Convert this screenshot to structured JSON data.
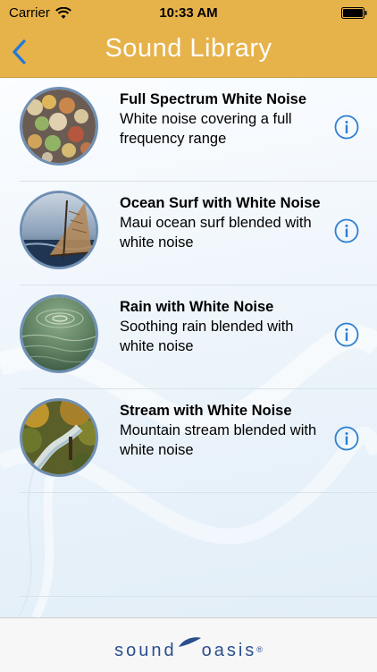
{
  "status_bar": {
    "carrier": "Carrier",
    "time": "10:33 AM",
    "wifi_icon": "wifi-icon",
    "battery_icon": "battery-icon"
  },
  "nav": {
    "title": "Sound Library",
    "back_icon": "chevron-left-icon"
  },
  "colors": {
    "nav_bg": "#e6b24a",
    "accent": "#2d7fd0",
    "thumb_border": "#6f8fb3",
    "brand": "#2a4f8c"
  },
  "sounds": [
    {
      "title": "Full Spectrum White Noise",
      "subtitle": "White noise covering a full frequency range",
      "image": "bokeh-lights"
    },
    {
      "title": "Ocean Surf with White Noise",
      "subtitle": "Maui ocean surf blended with white noise",
      "image": "sailboat-ocean"
    },
    {
      "title": "Rain with White Noise",
      "subtitle": "Soothing rain blended with white noise",
      "image": "water-ripples"
    },
    {
      "title": "Stream with White Noise",
      "subtitle": "Mountain stream blended with white noise",
      "image": "forest-stream"
    }
  ],
  "footer": {
    "brand_left": "sound",
    "brand_right": "oasis",
    "brand_mark": "®"
  }
}
